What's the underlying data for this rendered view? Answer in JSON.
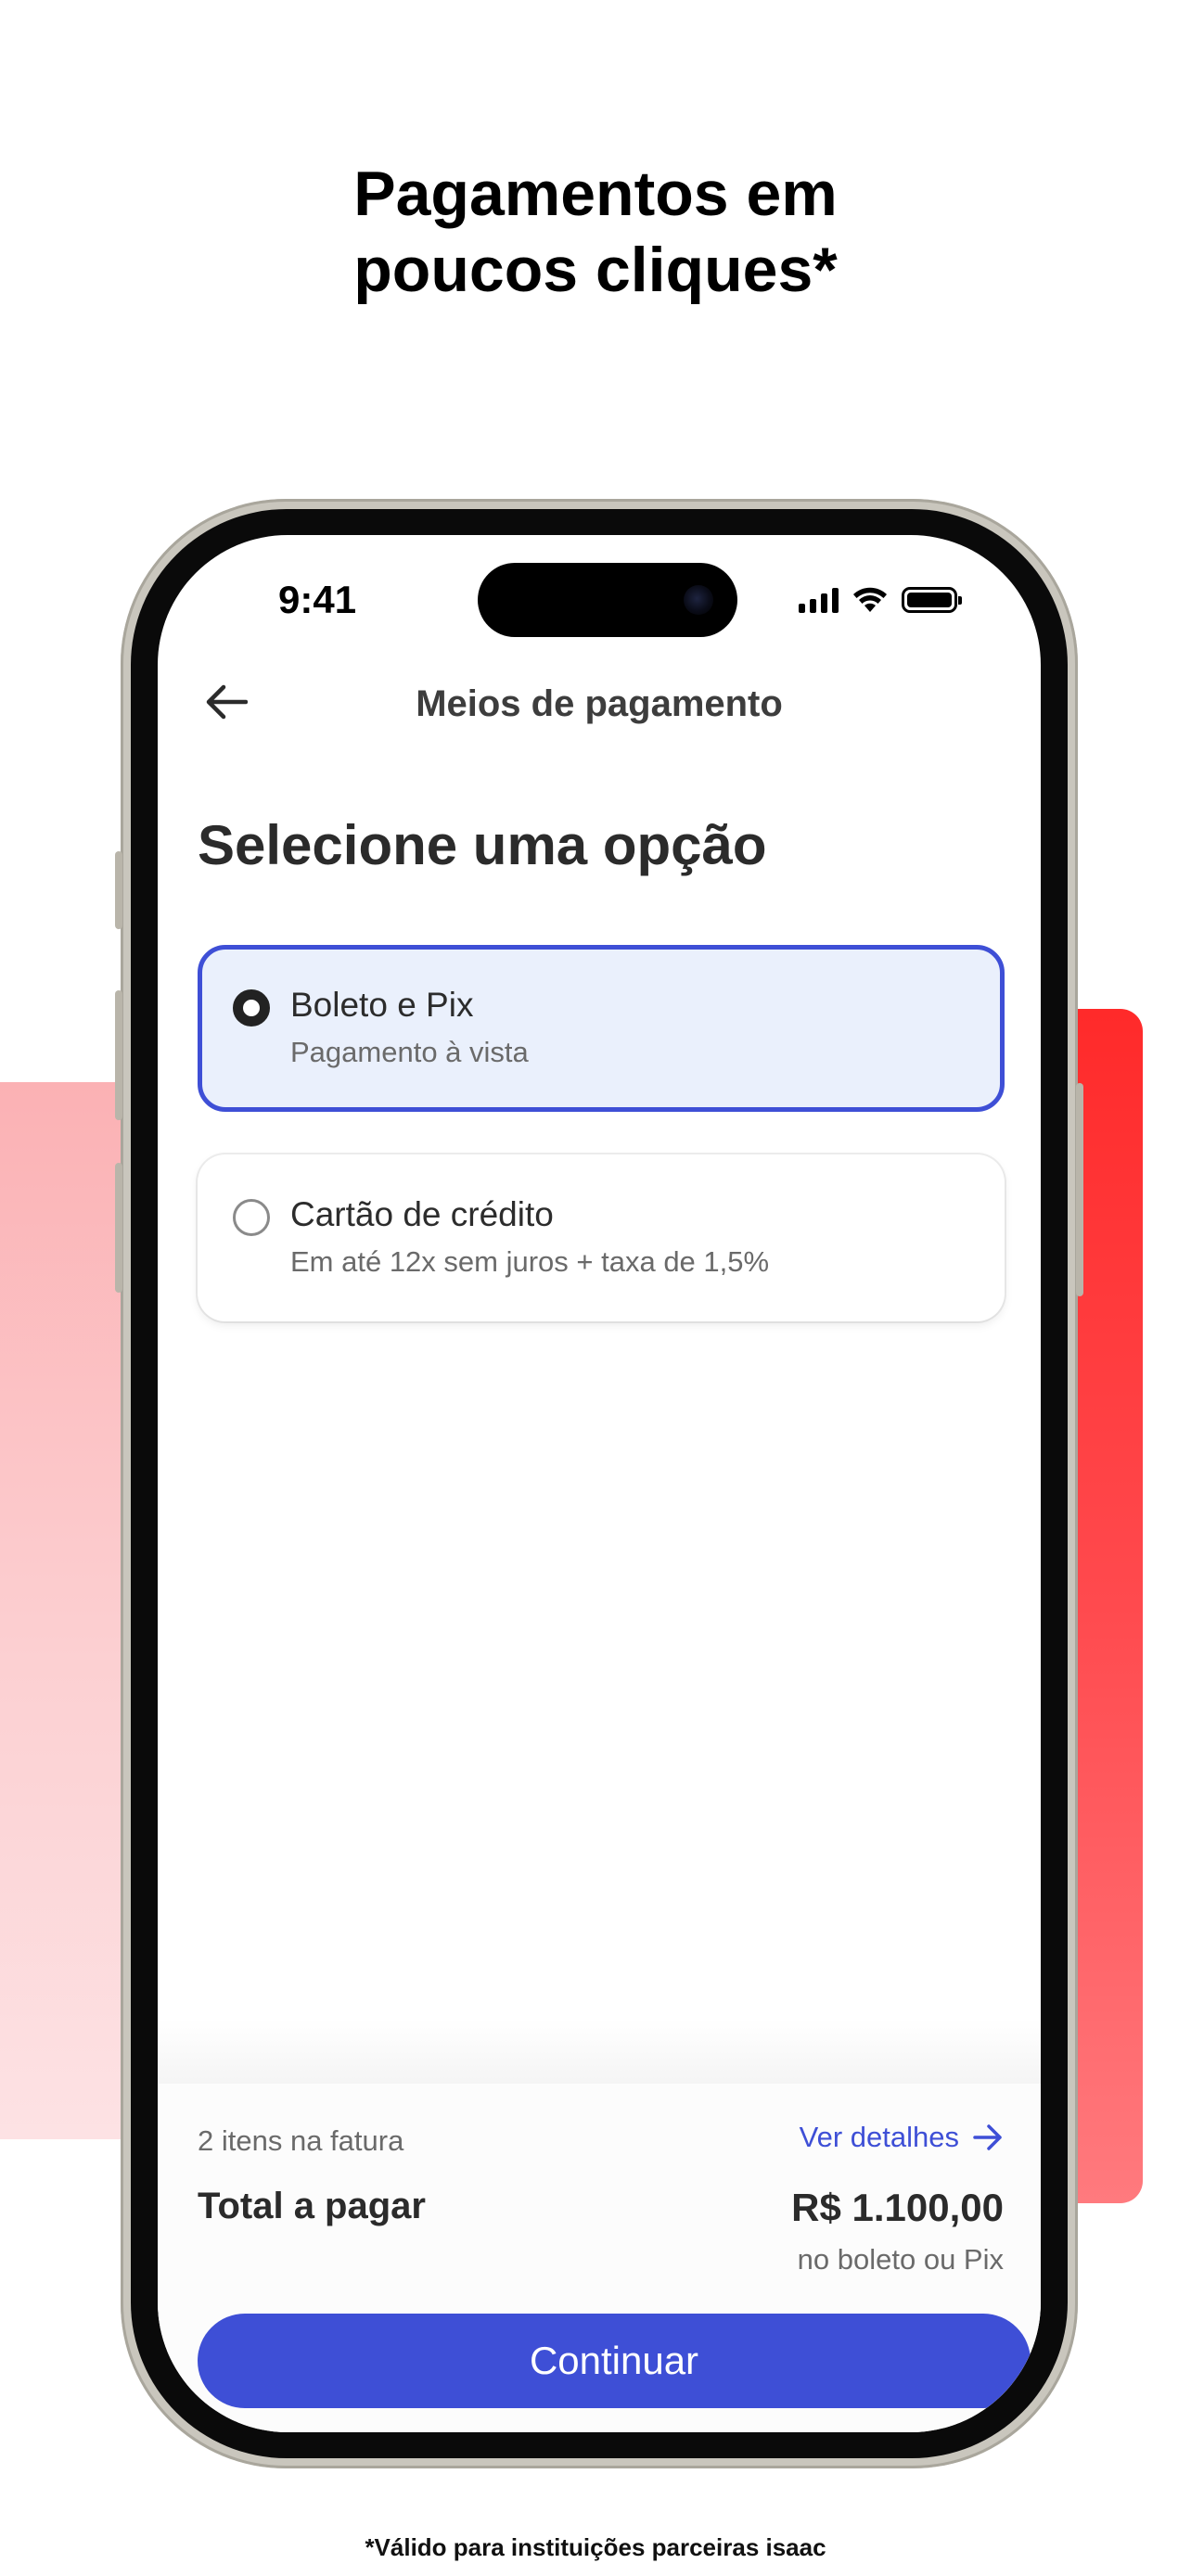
{
  "headline": {
    "line1": "Pagamentos em",
    "line2": "poucos cliques*"
  },
  "status_bar": {
    "time": "9:41"
  },
  "nav": {
    "title": "Meios de pagamento",
    "back_icon": "arrow-left-icon"
  },
  "section_title": "Selecione uma opção",
  "options": [
    {
      "title": "Boleto e Pix",
      "subtitle": "Pagamento à vista",
      "selected": true
    },
    {
      "title": "Cartão de crédito",
      "subtitle": "Em até 12x sem juros + taxa de 1,5%",
      "selected": false
    }
  ],
  "footer": {
    "items_count": "2 itens na fatura",
    "details_link": "Ver detalhes",
    "total_label": "Total a pagar",
    "total_value": "R$ 1.100,00",
    "total_note": "no boleto ou Pix",
    "cta_label": "Continuar"
  },
  "disclaimer": "*Válido para instituições parceiras isaac",
  "colors": {
    "accent": "#3e4fd6",
    "selected_bg": "#eaf0fc",
    "decor_red": "#ff2a2a"
  }
}
